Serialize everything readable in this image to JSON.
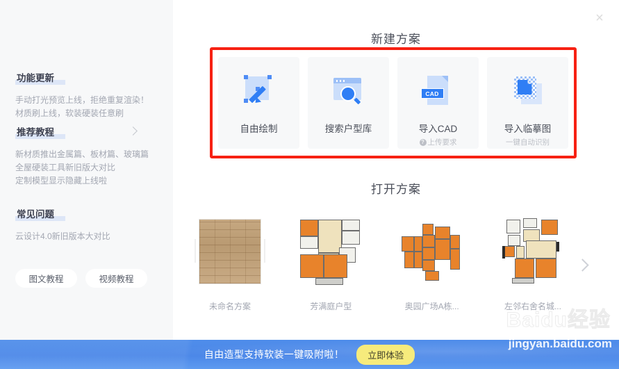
{
  "window": {
    "close_label": "×"
  },
  "sidebar": {
    "sections": [
      {
        "heading": "功能更新",
        "has_arrow": false,
        "lines": [
          "手动打光预览上线，拒绝重复渲染！",
          "材质刷上线，软装硬装任意刷"
        ]
      },
      {
        "heading": "推荐教程",
        "has_arrow": true,
        "lines": [
          "新材质推出金属篇、板材篇、玻璃篇",
          "全屋硬装工具新旧版大对比",
          "定制模型显示隐藏上线啦"
        ]
      },
      {
        "heading": "常见问题",
        "has_arrow": false,
        "lines": [
          "云设计4.0新旧版本大对比"
        ]
      }
    ],
    "buttons": [
      {
        "label": "图文教程"
      },
      {
        "label": "视频教程"
      }
    ]
  },
  "main": {
    "new_plan": {
      "title": "新建方案",
      "highlight_color": "#f72113",
      "cards": [
        {
          "icon": "free-draw-icon",
          "label": "自由绘制",
          "sub": ""
        },
        {
          "icon": "search-layout-library-icon",
          "label": "搜索户型库",
          "sub": ""
        },
        {
          "icon": "cad-file-icon",
          "label": "导入CAD",
          "sub": "上传要求",
          "sub_has_help_icon": true
        },
        {
          "icon": "trace-image-icon",
          "label": "导入临摹图",
          "sub": "一键自动识别",
          "sub_has_help_icon": false
        }
      ]
    },
    "open_plan": {
      "title": "打开方案",
      "plans": [
        {
          "name": "未命名方案",
          "thumb": "wood-floor"
        },
        {
          "name": "芳满庭户型",
          "thumb": "floorplan-a"
        },
        {
          "name": "奥园广场A栋...",
          "thumb": "floorplan-b"
        },
        {
          "name": "左邻右舍名城...",
          "thumb": "floorplan-c"
        }
      ],
      "next_label": "›"
    }
  },
  "banner": {
    "text": "自由造型支持软装一键吸附啦！",
    "button_label": "立即体验",
    "background_color": "#4b87e8",
    "button_color": "#f6eb7c"
  },
  "watermark": {
    "logo_text": "Baidu经验",
    "url_text": "jingyan.baidu.com"
  }
}
